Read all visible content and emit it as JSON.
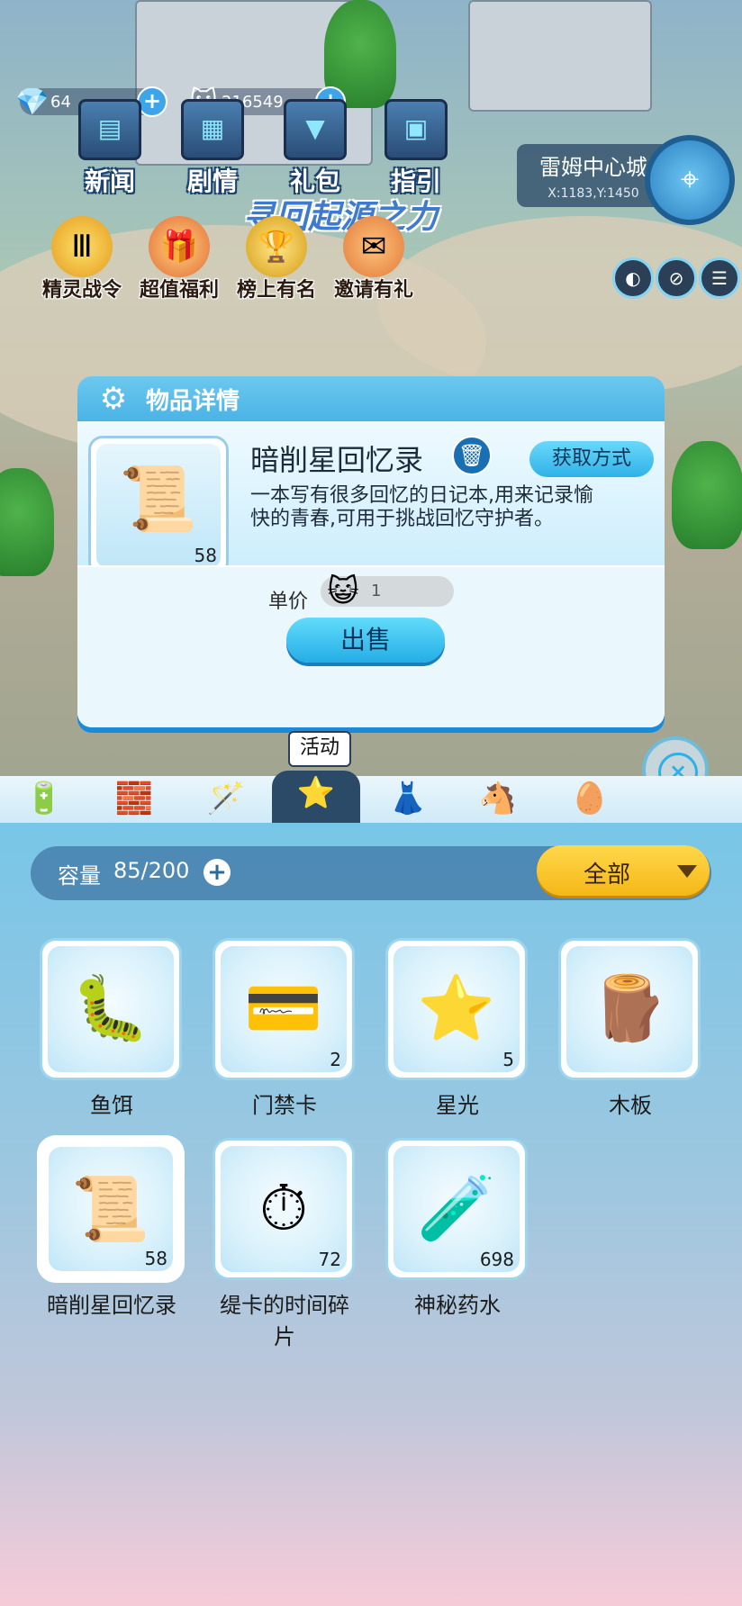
{
  "resources": {
    "gems": {
      "icon": "diamond-icon",
      "value": "64"
    },
    "coins": {
      "icon": "cat-coin-icon",
      "value": "216549"
    }
  },
  "top_menu": [
    {
      "label": "新闻",
      "icon": "news-icon"
    },
    {
      "label": "剧情",
      "icon": "story-icon"
    },
    {
      "label": "礼包",
      "icon": "gift-icon"
    },
    {
      "label": "指引",
      "icon": "guide-icon"
    }
  ],
  "banner_text": "寻回起源之力",
  "location": {
    "city": "雷姆中心城",
    "coords": "X:1183,Y:1450"
  },
  "activities": [
    {
      "label": "精灵战令",
      "icon": "battle-pass-icon"
    },
    {
      "label": "超值福利",
      "icon": "welfare-icon"
    },
    {
      "label": "榜上有名",
      "icon": "trophy-icon"
    },
    {
      "label": "邀请有礼",
      "icon": "invite-icon"
    }
  ],
  "dialog": {
    "title": "物品详情",
    "item_name": "暗削星回忆录",
    "item_count": "58",
    "acquire_label": "获取方式",
    "description": "一本写有很多回忆的日记本,用来记录愉快的青春,可用于挑战回忆守护者。",
    "price_label": "单价",
    "price_value": "1",
    "sell_label": "出售"
  },
  "tooltip": "活动",
  "tabs": [
    {
      "icon": "battery-icon",
      "active": false
    },
    {
      "icon": "blocks-icon",
      "active": false
    },
    {
      "icon": "star-wand-icon",
      "active": false
    },
    {
      "icon": "star-box-icon",
      "active": true
    },
    {
      "icon": "dress-icon",
      "active": false
    },
    {
      "icon": "rocking-horse-icon",
      "active": false
    },
    {
      "icon": "egg-icon",
      "active": false
    }
  ],
  "inventory": {
    "capacity_label": "容量",
    "capacity_value": "85/200",
    "filter_label": "全部",
    "items": [
      {
        "name": "鱼饵",
        "qty": "",
        "icon": "bait-icon",
        "selected": false
      },
      {
        "name": "门禁卡",
        "qty": "2",
        "icon": "access-card-icon",
        "selected": false
      },
      {
        "name": "星光",
        "qty": "5",
        "icon": "starlight-icon",
        "selected": false
      },
      {
        "name": "木板",
        "qty": "",
        "icon": "plank-icon",
        "selected": false
      },
      {
        "name": "暗削星回忆录",
        "qty": "58",
        "icon": "scroll-icon",
        "selected": true
      },
      {
        "name": "缇卡的时间碎片",
        "qty": "72",
        "icon": "clock-fragment-icon",
        "selected": false
      },
      {
        "name": "神秘药水",
        "qty": "698",
        "icon": "potion-icon",
        "selected": false
      }
    ]
  }
}
